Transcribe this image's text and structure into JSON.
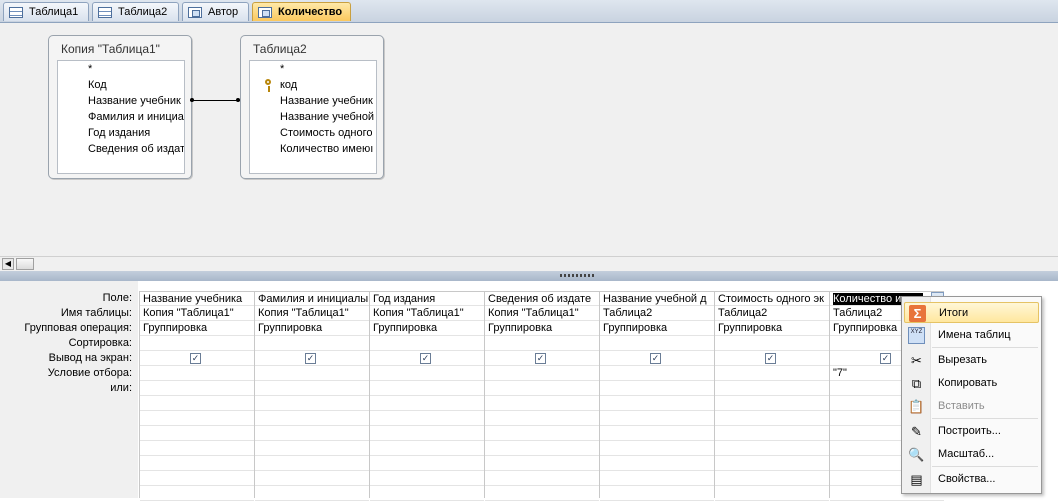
{
  "tabs": [
    {
      "label": "Таблица1",
      "icon": "table-icon"
    },
    {
      "label": "Таблица2",
      "icon": "table-icon"
    },
    {
      "label": "Автор",
      "icon": "query-icon"
    },
    {
      "label": "Количество",
      "icon": "query-icon",
      "active": true
    }
  ],
  "diagram": {
    "table1": {
      "title": "Копия \"Таблица1\"",
      "fields": [
        "*",
        "Код",
        "Название учебник",
        "Фамилия и инициа",
        "Год издания",
        "Сведения об издат"
      ]
    },
    "table2": {
      "title": "Таблица2",
      "fields": [
        "*",
        "код",
        "Название учебник",
        "Название учебной",
        "Стоимость одного",
        "Количество имеюı"
      ]
    }
  },
  "grid": {
    "row_labels": [
      "Поле:",
      "Имя таблицы:",
      "Групповая операция:",
      "Сортировка:",
      "Вывод на экран:",
      "Условие отбора:",
      "или:"
    ],
    "columns": [
      {
        "field": "Название учебника",
        "table": "Копия \"Таблица1\"",
        "group": "Группировка",
        "show": true,
        "criteria": ""
      },
      {
        "field": "Фамилия и инициалы",
        "table": "Копия \"Таблица1\"",
        "group": "Группировка",
        "show": true,
        "criteria": ""
      },
      {
        "field": "Год издания",
        "table": "Копия \"Таблица1\"",
        "group": "Группировка",
        "show": true,
        "criteria": ""
      },
      {
        "field": "Сведения об издате",
        "table": "Копия \"Таблица1\"",
        "group": "Группировка",
        "show": true,
        "criteria": ""
      },
      {
        "field": "Название учебной д",
        "table": "Таблица2",
        "group": "Группировка",
        "show": true,
        "criteria": ""
      },
      {
        "field": "Стоимость одного эк",
        "table": "Таблица2",
        "group": "Группировка",
        "show": true,
        "criteria": ""
      },
      {
        "field": "Количество имею",
        "table": "Таблица2",
        "group": "Группировка",
        "show": true,
        "criteria": "\"7\"",
        "selected": true
      }
    ],
    "check_glyph": "✓"
  },
  "context_menu": {
    "items": [
      {
        "label": "Итоги",
        "icon": "sigma-icon",
        "glyph": "Σ",
        "highlighted": true
      },
      {
        "label": "Имена таблиц",
        "icon": "table-names-icon",
        "glyph": "XYZ"
      },
      {
        "label": "Вырезать",
        "icon": "scissors-icon",
        "glyph": "✂"
      },
      {
        "label": "Копировать",
        "icon": "copy-icon",
        "glyph": "⧉"
      },
      {
        "label": "Вставить",
        "icon": "paste-icon",
        "glyph": "📋",
        "disabled": true
      },
      {
        "label": "Построить...",
        "icon": "build-icon",
        "glyph": "✎"
      },
      {
        "label": "Масштаб...",
        "icon": "zoom-icon",
        "glyph": "🔍"
      },
      {
        "label": "Свойства...",
        "icon": "properties-icon",
        "glyph": "▤"
      }
    ]
  },
  "scrollbar": {
    "left_arrow": "◀"
  }
}
